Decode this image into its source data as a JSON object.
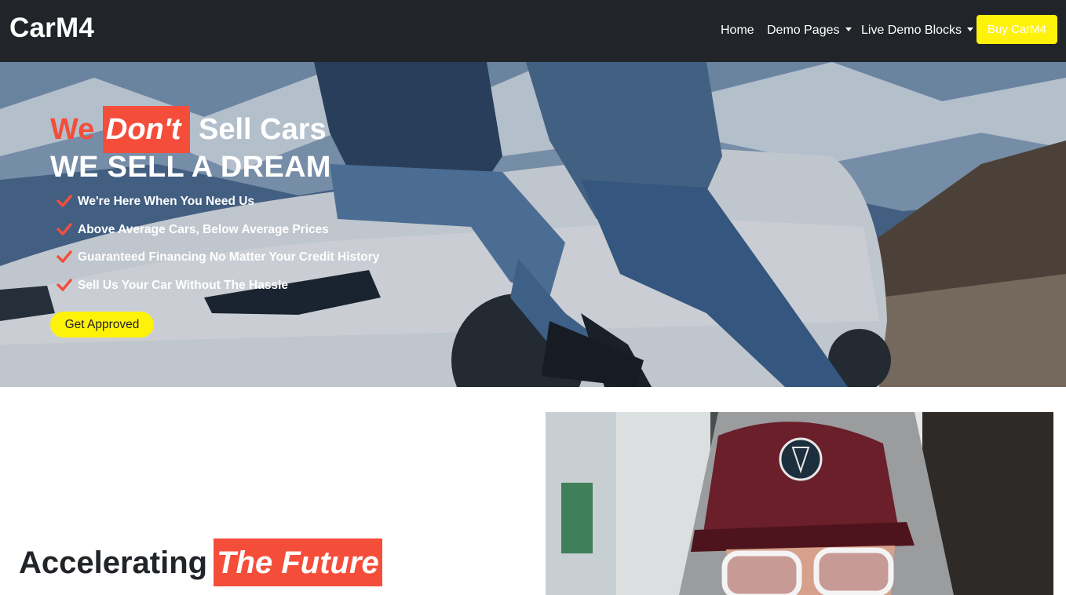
{
  "navbar": {
    "brand": "CarM4",
    "links": [
      {
        "label": "Home"
      },
      {
        "label": "Demo Pages",
        "dropdown": true
      },
      {
        "label": "Live Demo Blocks",
        "dropdown": true
      }
    ],
    "buy_button": "Buy CarM4"
  },
  "hero": {
    "title_we": "We",
    "title_highlight": "Don't",
    "title_rest": "Sell Cars",
    "subtitle": "WE SELL A DREAM",
    "features": [
      "We're Here When You Need Us",
      "Above Average Cars, Below Average Prices",
      "Guaranteed Financing No Matter Your Credit History",
      "Sell Us Your Car Without The Hassle"
    ],
    "cta_button": "Get Approved",
    "check_icon": "check-icon"
  },
  "section": {
    "heading": "Accelerating",
    "heading_highlight": "The Future"
  },
  "colors": {
    "navbar_bg": "#212428",
    "accent_yellow": "#fff20a",
    "accent_red": "#f44e3b"
  }
}
